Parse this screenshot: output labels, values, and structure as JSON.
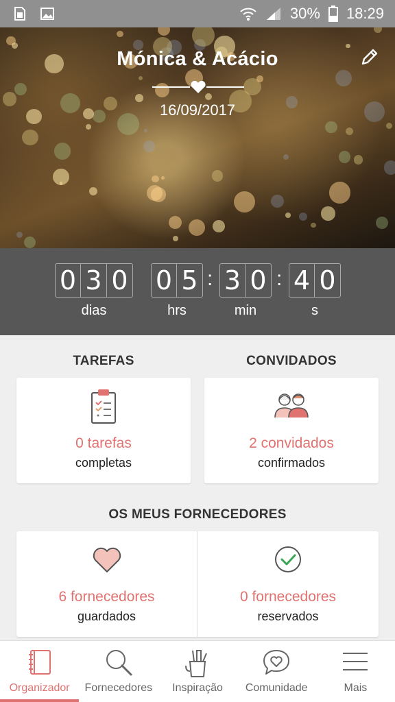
{
  "status_bar": {
    "left_icons": [
      "sim-card-icon",
      "image-icon"
    ],
    "battery": "30%",
    "time": "18:29"
  },
  "hero": {
    "couple": "Mónica & Acácio",
    "date": "16/09/2017",
    "edit_icon": "pencil-icon"
  },
  "countdown": {
    "days": [
      "0",
      "3",
      "0"
    ],
    "hours": [
      "0",
      "5"
    ],
    "minutes": [
      "3",
      "0"
    ],
    "seconds": [
      "4",
      "0"
    ],
    "labels": {
      "days": "dias",
      "hours": "hrs",
      "minutes": "min",
      "seconds": "s"
    }
  },
  "sections": {
    "tarefas": {
      "title": "TAREFAS",
      "value": "0 tarefas",
      "sub": "completas"
    },
    "convidados": {
      "title": "CONVIDADOS",
      "value": "2 convidados",
      "sub": "confirmados"
    },
    "fornecedores": {
      "title": "OS MEUS FORNECEDORES",
      "guardados_value": "6 fornecedores",
      "guardados_sub": "guardados",
      "reservados_value": "0 fornecedores",
      "reservados_sub": "reservados"
    }
  },
  "bottom_nav": [
    {
      "label": "Organizador",
      "icon": "notebook-icon",
      "active": true
    },
    {
      "label": "Fornecedores",
      "icon": "search-icon",
      "active": false
    },
    {
      "label": "Inspiração",
      "icon": "pencil-cup-icon",
      "active": false
    },
    {
      "label": "Comunidade",
      "icon": "chat-heart-icon",
      "active": false
    },
    {
      "label": "Mais",
      "icon": "menu-icon",
      "active": false
    }
  ],
  "colors": {
    "accent": "#e07270",
    "countdown_bg": "#575757",
    "status_bar": "#909090"
  }
}
